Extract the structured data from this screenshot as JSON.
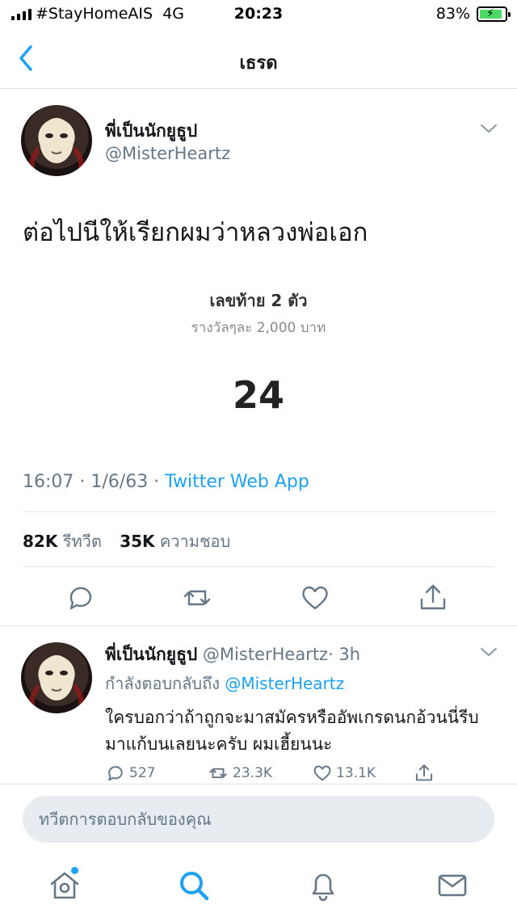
{
  "status_bar": {
    "carrier": "#StayHomeAIS",
    "network": "4G",
    "time": "20:23",
    "battery": "83%",
    "battery_level": 0.83
  },
  "nav": {
    "title": "เธรด"
  },
  "tweet": {
    "author_name": "พี่เป็นนักยูธูป",
    "author_handle": "@MisterHeartz",
    "text": "ต่อไปนีให้เรียกผมว่าหลวงพ่อเอก",
    "image": {
      "label": "เลขท้าย 2 ตัว",
      "sublabel": "รางวัลๆละ 2,000 บาท",
      "number": "24"
    },
    "timestamp": "16:07 · 1/6/63 · ",
    "source": "Twitter Web App",
    "retweets_count": "82K",
    "retweets_label": "รีทวีต",
    "likes_count": "35K",
    "likes_label": "ความชอบ"
  },
  "reply": {
    "author_name": "พี่เป็นนักยูธูป",
    "author_handle": "@MisterHeartz",
    "time": "· 3h",
    "replying_prefix": "กำลังตอบกลับถึง",
    "replying_to": "@MisterHeartz",
    "text": "ใครบอกว่าถ้าถูกจะมาสมัครหรืออัพเกรดนกอ้วนนี่รีบมาแก้บนเลยนะครับ ผมเฮี้ยนนะ",
    "reply_count": "527",
    "retweet_count": "23.3K",
    "like_count": "13.1K"
  },
  "compose": {
    "placeholder": "ทวีตการตอบกลับของคุณ"
  },
  "colors": {
    "accent": "#1da1f2",
    "secondary_text": "#657786",
    "divider": "#e1e8ed"
  },
  "tab_bar": {
    "icons": [
      "home-icon",
      "search-icon",
      "notifications-icon",
      "messages-icon"
    ],
    "active": "search-icon"
  }
}
